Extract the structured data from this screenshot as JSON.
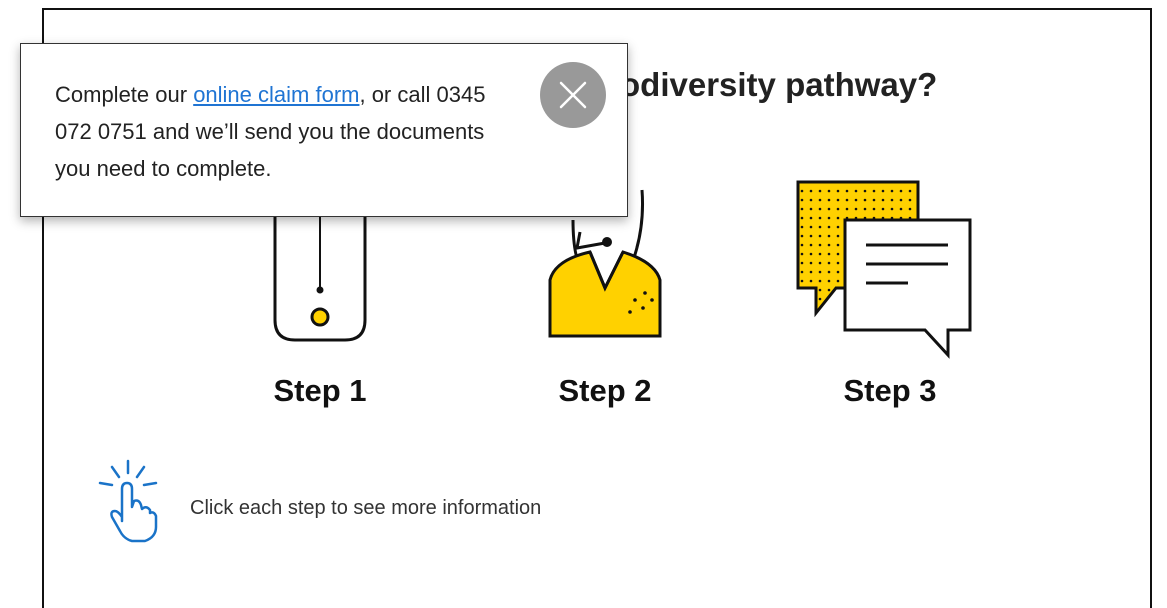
{
  "heading": {
    "visible_text": "odiversity pathway?"
  },
  "steps": [
    {
      "label": "Step 1",
      "icon": "phone-icon"
    },
    {
      "label": "Step 2",
      "icon": "call-agent-icon"
    },
    {
      "label": "Step 3",
      "icon": "documents-speech-bubbles-icon"
    }
  ],
  "hint": {
    "text": "Click each step to see more information",
    "icon": "pointer-click-icon"
  },
  "popup": {
    "text_before_link": "Complete our ",
    "link_text": "online claim form",
    "text_after_link": ", or call 0345 072 0751 and we’ll send you the documents you need to complete.",
    "close_icon": "close-icon"
  },
  "colors": {
    "accent_yellow": "#FFD100",
    "link_blue": "#1F74D3",
    "hint_icon_blue": "#1A73C8",
    "close_button_gray": "#999999"
  }
}
